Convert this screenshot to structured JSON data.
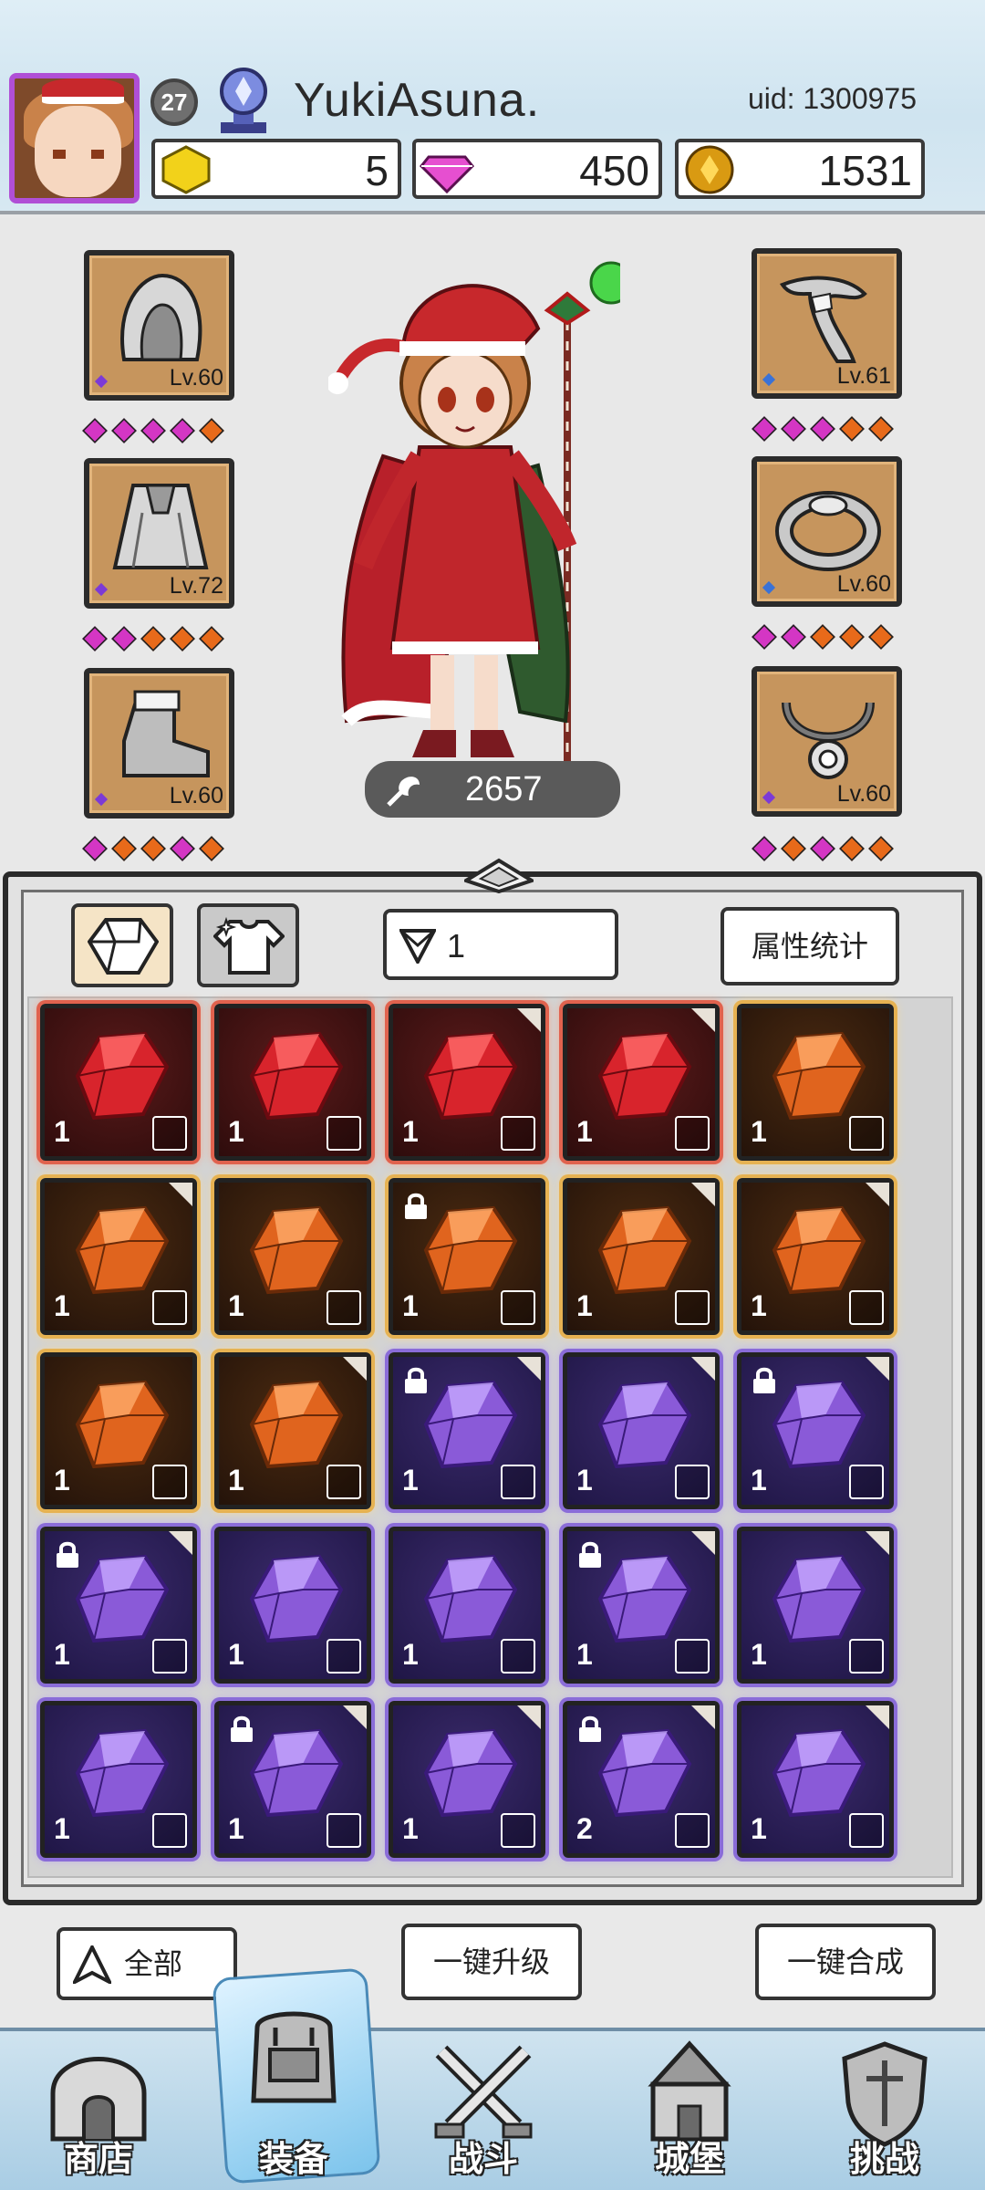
{
  "player": {
    "level": "27",
    "name": "YukiAsuna.",
    "uid": "uid: 1300975"
  },
  "currencies": [
    {
      "icon": "gold-gem-icon",
      "value": "5",
      "color": "#f2d21a"
    },
    {
      "icon": "pink-diamond-icon",
      "value": "450",
      "color": "#e64fd0"
    },
    {
      "icon": "gold-coin-icon",
      "value": "1531",
      "color": "#d99a12"
    }
  ],
  "equipment": {
    "left": [
      {
        "icon": "hood-icon",
        "level": "Lv.60",
        "diamonds": [
          "#d436c4",
          "#d436c4",
          "#d436c4",
          "#d436c4",
          "#e86a1a"
        ]
      },
      {
        "icon": "cape-icon",
        "level": "Lv.72",
        "diamonds": [
          "#d436c4",
          "#d436c4",
          "#e86a1a",
          "#e86a1a",
          "#e86a1a"
        ]
      },
      {
        "icon": "boot-icon",
        "level": "Lv.60",
        "diamonds": [
          "#d436c4",
          "#e86a1a",
          "#e86a1a",
          "#d436c4",
          "#e86a1a"
        ]
      }
    ],
    "right": [
      {
        "icon": "horn-weapon-icon",
        "level": "Lv.61",
        "diamonds": [
          "#d436c4",
          "#d436c4",
          "#d436c4",
          "#e86a1a",
          "#e86a1a"
        ]
      },
      {
        "icon": "ring-icon",
        "level": "Lv.60",
        "diamonds": [
          "#d436c4",
          "#d436c4",
          "#e86a1a",
          "#e86a1a",
          "#e86a1a"
        ]
      },
      {
        "icon": "necklace-icon",
        "level": "Lv.60",
        "diamonds": [
          "#d436c4",
          "#e86a1a",
          "#d436c4",
          "#e86a1a",
          "#e86a1a"
        ]
      }
    ]
  },
  "power": "2657",
  "inventory": {
    "filter_value": "1",
    "stats_button": "属性统计",
    "gems": [
      {
        "tier": "red",
        "qty": "1",
        "locked": false,
        "corner": false
      },
      {
        "tier": "red",
        "qty": "1",
        "locked": false,
        "corner": false
      },
      {
        "tier": "red",
        "qty": "1",
        "locked": false,
        "corner": true
      },
      {
        "tier": "red",
        "qty": "1",
        "locked": false,
        "corner": true
      },
      {
        "tier": "orange",
        "qty": "1",
        "locked": false,
        "corner": false
      },
      {
        "tier": "orange",
        "qty": "1",
        "locked": false,
        "corner": true
      },
      {
        "tier": "orange",
        "qty": "1",
        "locked": false,
        "corner": false
      },
      {
        "tier": "orange",
        "qty": "1",
        "locked": true,
        "corner": false
      },
      {
        "tier": "orange",
        "qty": "1",
        "locked": false,
        "corner": true
      },
      {
        "tier": "orange",
        "qty": "1",
        "locked": false,
        "corner": true
      },
      {
        "tier": "orange",
        "qty": "1",
        "locked": false,
        "corner": false
      },
      {
        "tier": "orange",
        "qty": "1",
        "locked": false,
        "corner": true
      },
      {
        "tier": "purple",
        "qty": "1",
        "locked": true,
        "corner": true
      },
      {
        "tier": "purple",
        "qty": "1",
        "locked": false,
        "corner": true
      },
      {
        "tier": "purple",
        "qty": "1",
        "locked": true,
        "corner": true
      },
      {
        "tier": "purple",
        "qty": "1",
        "locked": true,
        "corner": true
      },
      {
        "tier": "purple",
        "qty": "1",
        "locked": false,
        "corner": false
      },
      {
        "tier": "purple",
        "qty": "1",
        "locked": false,
        "corner": false
      },
      {
        "tier": "purple",
        "qty": "1",
        "locked": true,
        "corner": true
      },
      {
        "tier": "purple",
        "qty": "1",
        "locked": false,
        "corner": true
      },
      {
        "tier": "purple",
        "qty": "1",
        "locked": false,
        "corner": false
      },
      {
        "tier": "purple",
        "qty": "1",
        "locked": true,
        "corner": true
      },
      {
        "tier": "purple",
        "qty": "1",
        "locked": false,
        "corner": true
      },
      {
        "tier": "purple",
        "qty": "2",
        "locked": true,
        "corner": true
      },
      {
        "tier": "purple",
        "qty": "1",
        "locked": false,
        "corner": true
      }
    ]
  },
  "actions": {
    "all_label": "全部",
    "upgrade_label": "一键升级",
    "merge_label": "一键合成"
  },
  "nav": [
    {
      "label": "商店",
      "icon": "shop-icon",
      "active": false
    },
    {
      "label": "装备",
      "icon": "backpack-icon",
      "active": true
    },
    {
      "label": "战斗",
      "icon": "crossed-swords-icon",
      "active": false
    },
    {
      "label": "城堡",
      "icon": "castle-icon",
      "active": false
    },
    {
      "label": "挑战",
      "icon": "shield-challenge-icon",
      "active": false
    }
  ]
}
